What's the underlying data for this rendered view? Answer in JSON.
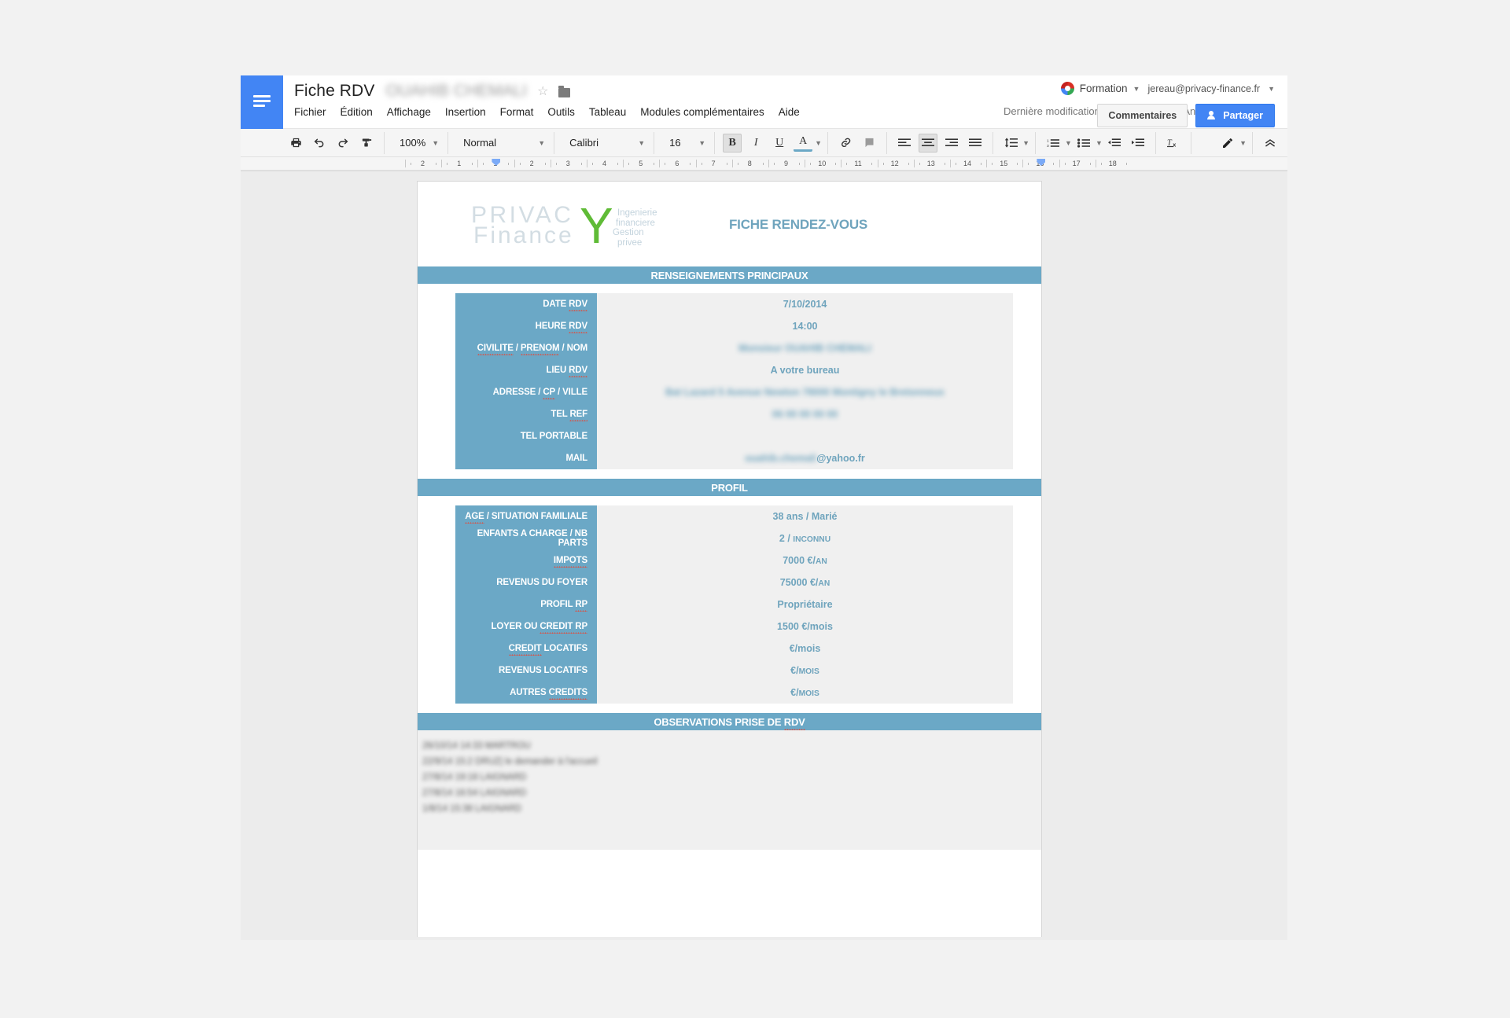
{
  "app": {
    "logo_icon": "docs-logo-icon",
    "title": "Fiche RDV",
    "title_redacted": "OUAHIB CHEMALI",
    "star_icon": "star-icon",
    "folder_icon": "folder-icon",
    "menu": [
      "Fichier",
      "Édition",
      "Affichage",
      "Insertion",
      "Format",
      "Outils",
      "Tableau",
      "Modules complémentaires",
      "Aide"
    ],
    "last_edit": "Dernière modification il y a 10 jours par Angélique Abi…",
    "account": {
      "avatar_icon": "chrome-profile-icon",
      "profile_name": "Formation",
      "email": "jereau@privacy-finance.fr",
      "caret_icon": "chevron-down-icon"
    },
    "comments_label": "Commentaires",
    "share_label": "Partager",
    "share_icon": "person-add-icon"
  },
  "toolbar": {
    "print_icon": "print-icon",
    "undo_icon": "undo-icon",
    "redo_icon": "redo-icon",
    "paint_format_icon": "paint-format-icon",
    "zoom": "100%",
    "style": "Normal",
    "font": "Calibri",
    "font_size": "16",
    "bold_label": "B",
    "italic_label": "I",
    "underline_label": "U",
    "text_color_label": "A",
    "link_icon": "link-icon",
    "comment_icon": "add-comment-icon",
    "align_left_icon": "align-left-icon",
    "align_center_icon": "align-center-icon",
    "align_right_icon": "align-right-icon",
    "align_justify_icon": "align-justify-icon",
    "line_spacing_icon": "line-spacing-icon",
    "numbered_list_icon": "numbered-list-icon",
    "bulleted_list_icon": "bulleted-list-icon",
    "outdent_icon": "decrease-indent-icon",
    "indent_icon": "increase-indent-icon",
    "clear_format_icon": "clear-formatting-icon",
    "edit_mode_icon": "pencil-icon",
    "collapse_icon": "chevron-up-icon"
  },
  "ruler": {
    "ticks": [
      "2",
      "1",
      "1",
      "2",
      "3",
      "4",
      "5",
      "6",
      "7",
      "8",
      "9",
      "10",
      "11",
      "12",
      "13",
      "14",
      "15",
      "16",
      "17",
      "18"
    ]
  },
  "document": {
    "logo": {
      "word1": "PRIVAC",
      "word2": "Finance",
      "y": "Y",
      "tagline": [
        "Ingenierie",
        "financiere",
        "Gestion",
        "privee"
      ]
    },
    "main_title": "FICHE RENDEZ-VOUS",
    "sections": [
      {
        "band": "RENSEIGNEMENTS PRINCIPAUX",
        "band_squiggles": [],
        "rows": [
          {
            "label": "DATE RDV",
            "squiggle": "RDV",
            "value": "7/10/2014",
            "redacted": false
          },
          {
            "label": "HEURE RDV",
            "squiggle": "RDV",
            "value": "14:00",
            "redacted": false
          },
          {
            "label": "CIVILITE / PRENOM / NOM",
            "squiggle": "CIVILITE,PRENOM",
            "value": "Monsieur OUAHIB CHEMALI",
            "redacted": true
          },
          {
            "label": "LIEU RDV",
            "squiggle": "RDV",
            "value": "A votre bureau",
            "redacted": false
          },
          {
            "label": "ADRESSE / CP / VILLE",
            "squiggle": "CP",
            "value": "Bat Lazard 5 Avenue Newton 78000 Montigny le Bretonneux",
            "redacted": true
          },
          {
            "label": "TEL REF",
            "squiggle": "REF",
            "value": "06 00 00 00 00",
            "redacted": true
          },
          {
            "label": "TEL PORTABLE",
            "squiggle": "",
            "value": "",
            "redacted": false
          },
          {
            "label": "MAIL",
            "squiggle": "",
            "value": "ouahib.chemali@yahoo.fr",
            "redacted": "partial",
            "suffix": "@yahoo.fr"
          }
        ]
      },
      {
        "band": "PROFIL",
        "band_squiggles": [],
        "rows": [
          {
            "label": "AGE / SITUATION FAMILIALE",
            "squiggle": "AGE",
            "value": "38 ans  / Marié",
            "redacted": false
          },
          {
            "label": "ENFANTS A CHARGE / NB PARTS",
            "squiggle": "",
            "value": "2 / Inconnu",
            "smallcaps_from": 4,
            "redacted": false
          },
          {
            "label": "IMPOTS",
            "squiggle": "IMPOTS",
            "value": "7000 €/an",
            "smallcaps_from": 7,
            "redacted": false
          },
          {
            "label": "REVENUS DU FOYER",
            "squiggle": "",
            "value": "75000 €/an",
            "smallcaps_from": 8,
            "redacted": false
          },
          {
            "label": "PROFIL RP",
            "squiggle": "RP",
            "value": "Propriétaire",
            "redacted": false
          },
          {
            "label": "LOYER OU CREDIT RP",
            "squiggle": "CREDIT RP",
            "value": "1500 €/mois",
            "redacted": false
          },
          {
            "label": "CREDIT LOCATIFS",
            "squiggle": "CREDIT",
            "value": "€/mois",
            "redacted": false
          },
          {
            "label": "REVENUS LOCATIFS",
            "squiggle": "",
            "value": "€/mois",
            "smallcaps_from": 2,
            "redacted": false
          },
          {
            "label": "AUTRES CREDITS",
            "squiggle": "CREDITS",
            "value": "€/mois",
            "smallcaps_from": 2,
            "redacted": false
          }
        ]
      }
    ],
    "observations": {
      "band": "OBSERVATIONS PRISE DE RDV",
      "band_squiggle": "RDV",
      "lines": [
        "26/10/14 14:33 MARTROU",
        "22/9/14 15:2 DRUZ| le demander à l'accueil",
        "27/8/14 19:18 LAIGNARD",
        "27/8/14 16:54 LAIGNARD",
        "1/8/14 15:38 LAIGNARD"
      ]
    }
  },
  "colors": {
    "band_blue": "#6ba8c6",
    "value_blue": "#6fa4bd",
    "cell_grey": "#f0f0f0",
    "accent_green": "#5fbb36",
    "google_blue": "#4285f4"
  }
}
